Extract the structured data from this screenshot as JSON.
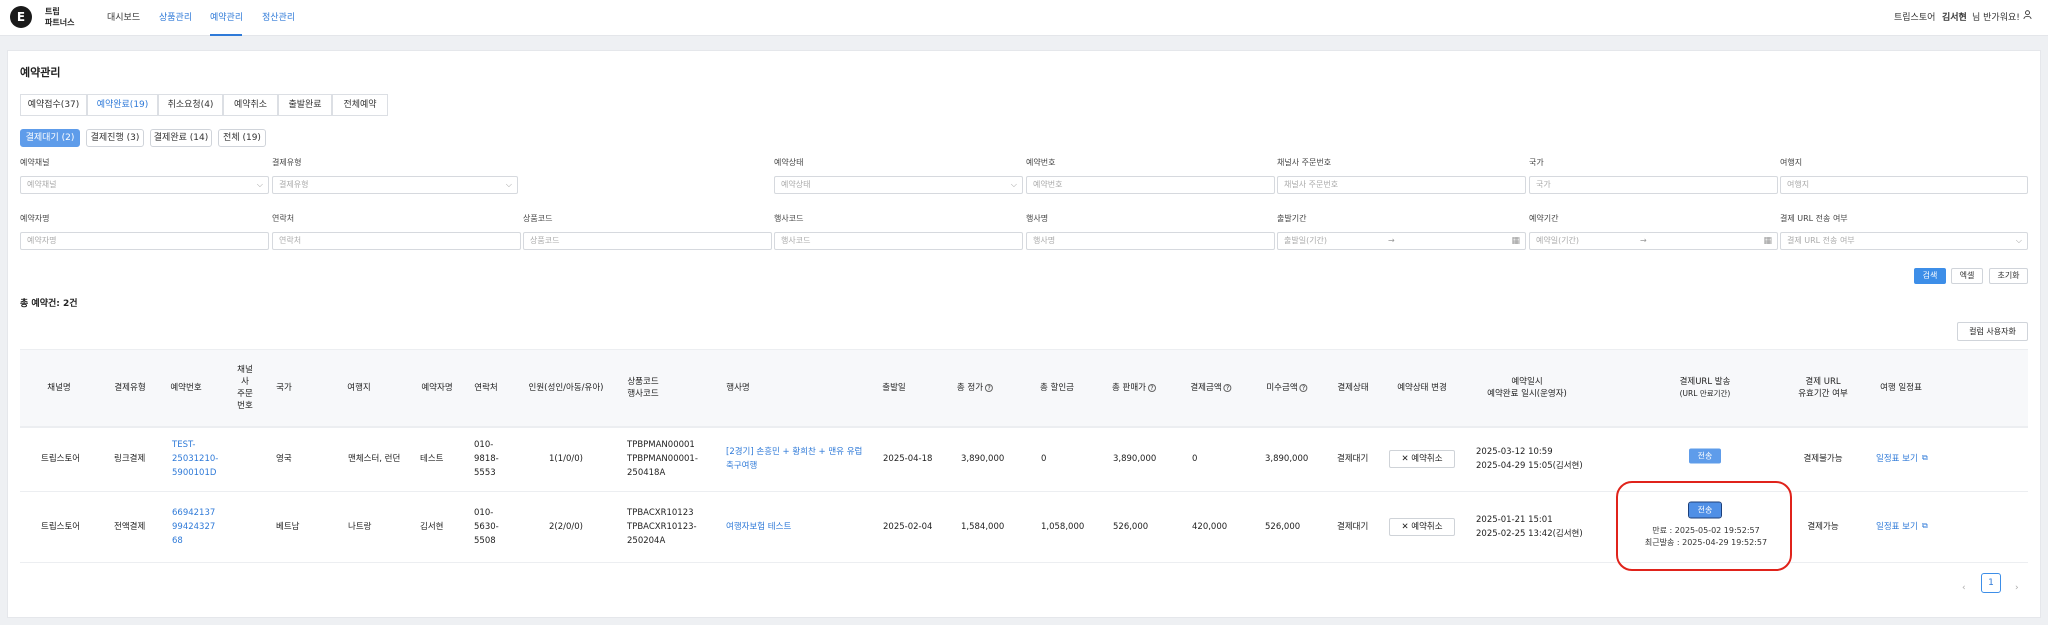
{
  "header": {
    "logo_letter": "E",
    "brand_line1": "트립",
    "brand_line2": "파트너스",
    "nav": [
      "대시보드",
      "상품관리",
      "예약관리",
      "정산관리"
    ],
    "store": "트립스토어",
    "user": "김서현",
    "greeting": "님 반가워요!"
  },
  "page": {
    "title": "예약관리",
    "tabs": [
      "예약접수(37)",
      "예약완료(19)",
      "취소요청(4)",
      "예약취소",
      "출발완료",
      "전체예약"
    ],
    "chips": [
      "결제대기 (2)",
      "결제진행 (3)",
      "결제완료 (14)",
      "전체 (19)"
    ]
  },
  "filters": {
    "row1": [
      {
        "label": "예약채널",
        "placeholder": "예약채널"
      },
      {
        "label": "결제유형",
        "placeholder": "결제유형"
      },
      {
        "label": "예약상태",
        "placeholder": "예약상태"
      },
      {
        "label": "예약번호",
        "placeholder": "예약번호"
      },
      {
        "label": "채널사 주문번호",
        "placeholder": "채널사 주문번호"
      },
      {
        "label": "국가",
        "placeholder": "국가"
      },
      {
        "label": "여행지",
        "placeholder": "여행지"
      }
    ],
    "row2": [
      {
        "label": "예약자명",
        "placeholder": "예약자명"
      },
      {
        "label": "연락처",
        "placeholder": "연락처"
      },
      {
        "label": "상품코드",
        "placeholder": "상품코드"
      },
      {
        "label": "행사코드",
        "placeholder": "행사코드"
      },
      {
        "label": "행사명",
        "placeholder": "행사명"
      },
      {
        "label": "출발기간",
        "placeholder": "출발일(기간)"
      },
      {
        "label": "예약기간",
        "placeholder": "예약일(기간)"
      },
      {
        "label": "결제 URL 전송 여부",
        "placeholder": "결제 URL 전송 여부"
      }
    ],
    "range_arrow": "→",
    "buttons": {
      "search": "검색",
      "excel": "엑셀",
      "reset": "초기화"
    }
  },
  "summary": {
    "total": "총 예약건: 2건",
    "column_settings": "컬럼 사용자화"
  },
  "table": {
    "headers": {
      "channel": "채널명",
      "paytype": "결제유형",
      "resno": "예약번호",
      "chno": "채널\n사\n주문\n번호",
      "country": "국가",
      "dest": "여행지",
      "name": "예약자명",
      "phone": "연락처",
      "people": "인원(성인/아동/유아)",
      "codes": "상품코드\n행사코드",
      "event": "행사명",
      "depart": "출발일",
      "price": "총 정가",
      "discount": "총 할인금",
      "sale": "총 판매가",
      "paid": "결제금액",
      "unpaid": "미수금액",
      "paystatus": "결제상태",
      "change": "예약상태 변경",
      "dates": "예약일시\n예약완료 일시(운영자)",
      "payurl": "결제URL 발송",
      "payurl_sub": "(URL 만료기간)",
      "urlvalid": "결제 URL\n유효기간 여부",
      "itinerary": "여행 일정표"
    },
    "rows": [
      {
        "channel": "트립스토어",
        "paytype": "링크결제",
        "resno": "TEST-\n25031210-\n5900101D",
        "country": "영국",
        "dest": "맨체스터, 런던",
        "name": "테스트",
        "phone": "010-\n9818-\n5553",
        "people": "1(1/0/0)",
        "codes": "TPBPMAN00001\nTPBPMAN00001-\n250418A",
        "event": "[2경기] 손흥민 + 황희찬 + 맨유 유럽\n축구여행",
        "depart": "2025-04-18",
        "price": "3,890,000",
        "discount": "0",
        "sale": "3,890,000",
        "paid": "0",
        "unpaid": "3,890,000",
        "paystatus": "결제대기",
        "cancel": "예약취소",
        "dates": "2025-03-12 10:59\n2025-04-29 15:05(김서현)",
        "send": "전송",
        "urlvalid": "결제불가능",
        "itinerary": "일정표 보기"
      },
      {
        "channel": "트립스토어",
        "paytype": "전액결제",
        "resno": "66942137\n99424327\n68",
        "country": "베트남",
        "dest": "나트랑",
        "name": "김서현",
        "phone": "010-\n5630-\n5508",
        "people": "2(2/0/0)",
        "codes": "TPBACXR10123\nTPBACXR10123-\n250204A",
        "event": "여행자보험 테스트",
        "depart": "2025-02-04",
        "price": "1,584,000",
        "discount": "1,058,000",
        "sale": "526,000",
        "paid": "420,000",
        "unpaid": "526,000",
        "paystatus": "결제대기",
        "cancel": "예약취소",
        "dates": "2025-01-21 15:01\n2025-02-25 13:42(김서현)",
        "send": "전송",
        "expire": "만료 : 2025-05-02 19:52:57",
        "resend": "최근발송 : 2025-04-29 19:52:57",
        "urlvalid": "결제가능",
        "itinerary": "일정표 보기"
      }
    ]
  },
  "pagination": {
    "prev": "‹",
    "page": "1",
    "next": "›"
  },
  "colors": {
    "accent": "#2f7ad8",
    "primary_btn": "#3d8ee8",
    "highlight": "#e0231b"
  }
}
